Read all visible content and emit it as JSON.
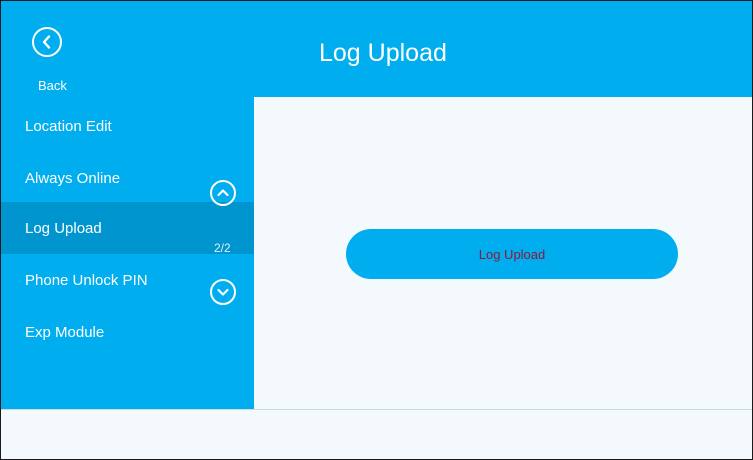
{
  "header": {
    "back_label": "Back",
    "title": "Log Upload",
    "back_icon": "chevron-left-circle-icon"
  },
  "sidebar": {
    "items": [
      {
        "label": "Location Edit",
        "selected": false
      },
      {
        "label": "Always Online",
        "selected": false
      },
      {
        "label": "Log Upload",
        "selected": true
      },
      {
        "label": "Phone Unlock PIN",
        "selected": false
      },
      {
        "label": "Exp Module",
        "selected": false
      }
    ],
    "page_indicator": "2/2",
    "scroll_up_icon": "chevron-up-circle-icon",
    "scroll_down_icon": "chevron-down-circle-icon"
  },
  "content": {
    "upload_button_label": "Log Upload"
  },
  "colors": {
    "accent": "#00aeef",
    "selected": "#0095cf",
    "background": "#f3f9fc",
    "button_text": "#8a1a3a"
  }
}
